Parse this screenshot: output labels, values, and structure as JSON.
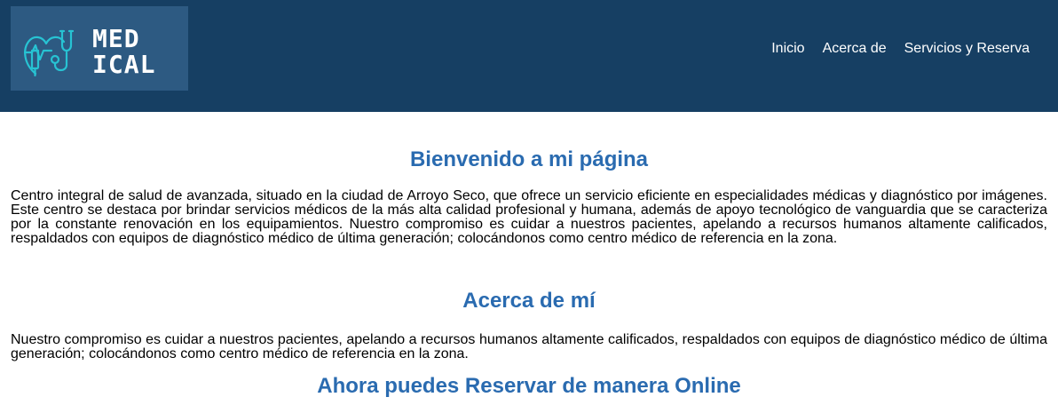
{
  "header": {
    "logo": {
      "line1": "MED",
      "line2": "ICAL",
      "icon": "stethoscope-heart-icon"
    },
    "nav": [
      {
        "label": "Inicio"
      },
      {
        "label": "Acerca de"
      },
      {
        "label": "Servicios y Reserva"
      }
    ]
  },
  "main": {
    "welcome": {
      "title": "Bienvenido a mi página",
      "text": "Centro integral de salud de avanzada, situado en la ciudad de Arroyo Seco, que ofrece un servicio eficiente en especialidades médicas y diagnóstico por imágenes. Este centro se destaca por brindar servicios médicos de la más alta calidad profesional y humana, además de apoyo tecnológico de vanguardia que se caracteriza por la constante renovación en los equipamientos. Nuestro compromiso es cuidar a nuestros pacientes, apelando a recursos humanos altamente calificados, respaldados con equipos de diagnóstico médico de última generación; colocándonos como centro médico de referencia en la zona."
    },
    "about": {
      "title": "Acerca de mí",
      "text": "Nuestro compromiso es cuidar a nuestros pacientes, apelando a recursos humanos altamente calificados, respaldados con equipos de diagnóstico médico de última generación; colocándonos como centro médico de referencia en la zona."
    },
    "online": {
      "title": "Ahora puedes Reservar de manera Online"
    }
  },
  "colors": {
    "header_bg": "#163f63",
    "logo_bg": "#2d5a82",
    "accent": "#2a6bb0",
    "logo_icon": "#27c3d3"
  }
}
